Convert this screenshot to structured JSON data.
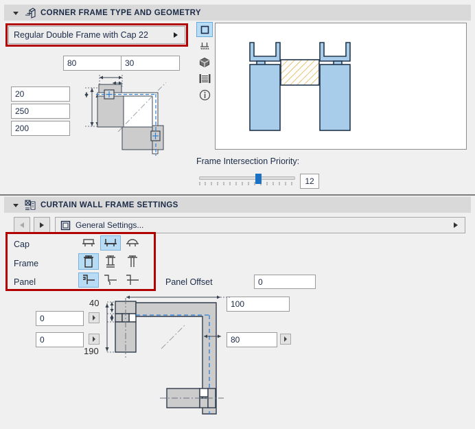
{
  "sections": {
    "corner": {
      "title": "CORNER FRAME TYPE AND GEOMETRY",
      "icon": "corner-frame-icon",
      "collapse_icon": "triangle-down-icon",
      "frame_type": {
        "label": "Regular Double Frame with Cap 22",
        "arrow_icon": "chevron-right-icon"
      },
      "fields": {
        "width_a": "80",
        "width_b": "30",
        "depth_a": "20",
        "depth_b": "250",
        "depth_c": "200"
      },
      "priority": {
        "label": "Frame Intersection Priority:",
        "value": "12",
        "min": 0,
        "max": 20
      },
      "preview_rail": [
        {
          "name": "2d-symbol-icon",
          "selected": true
        },
        {
          "name": "section-icon",
          "selected": false
        },
        {
          "name": "3d-model-icon",
          "selected": false
        },
        {
          "name": "elevation-icon",
          "selected": false
        },
        {
          "name": "info-icon",
          "selected": false
        }
      ]
    },
    "curtain": {
      "title": "CURTAIN WALL FRAME SETTINGS",
      "icon": "curtain-wall-icon",
      "collapse_icon": "triangle-down-icon",
      "nav": {
        "prev_icon": "triangle-left-icon",
        "next_icon": "triangle-right-icon",
        "settings_icon": "frame-square-icon",
        "settings_label": "General Settings...",
        "overflow_icon": "chevron-right-icon"
      },
      "rows": [
        {
          "label": "Cap",
          "options": [
            {
              "name": "cap-flat-icon",
              "selected": false
            },
            {
              "name": "cap-u-icon",
              "selected": true
            },
            {
              "name": "cap-round-icon",
              "selected": false
            }
          ]
        },
        {
          "label": "Frame",
          "options": [
            {
              "name": "frame-box-icon",
              "selected": true
            },
            {
              "name": "frame-i-icon",
              "selected": false
            },
            {
              "name": "frame-t-icon",
              "selected": false
            }
          ]
        },
        {
          "label": "Panel",
          "options": [
            {
              "name": "panel-inset-icon",
              "selected": true
            },
            {
              "name": "panel-offset-icon",
              "selected": false
            },
            {
              "name": "panel-flush-icon",
              "selected": false
            }
          ]
        }
      ],
      "panel_offset": {
        "label": "Panel Offset",
        "value": "0"
      },
      "geometry": {
        "left_top_value": "0",
        "left_bottom_value": "0",
        "right_top_value": "100",
        "right_bottom_value": "80",
        "dim_top": "40",
        "dim_bottom": "190",
        "stepper_icon": "triangle-right-icon"
      }
    }
  },
  "colors": {
    "accent_blue": "#1b72c4",
    "selected_fill": "#b9dcf5",
    "highlight_red": "#b00000",
    "preview_blue": "#a8cdea",
    "hatch_orange": "#d9a227",
    "panel_bg": "#f0f0f0",
    "header_bg": "#d9d9d9"
  }
}
